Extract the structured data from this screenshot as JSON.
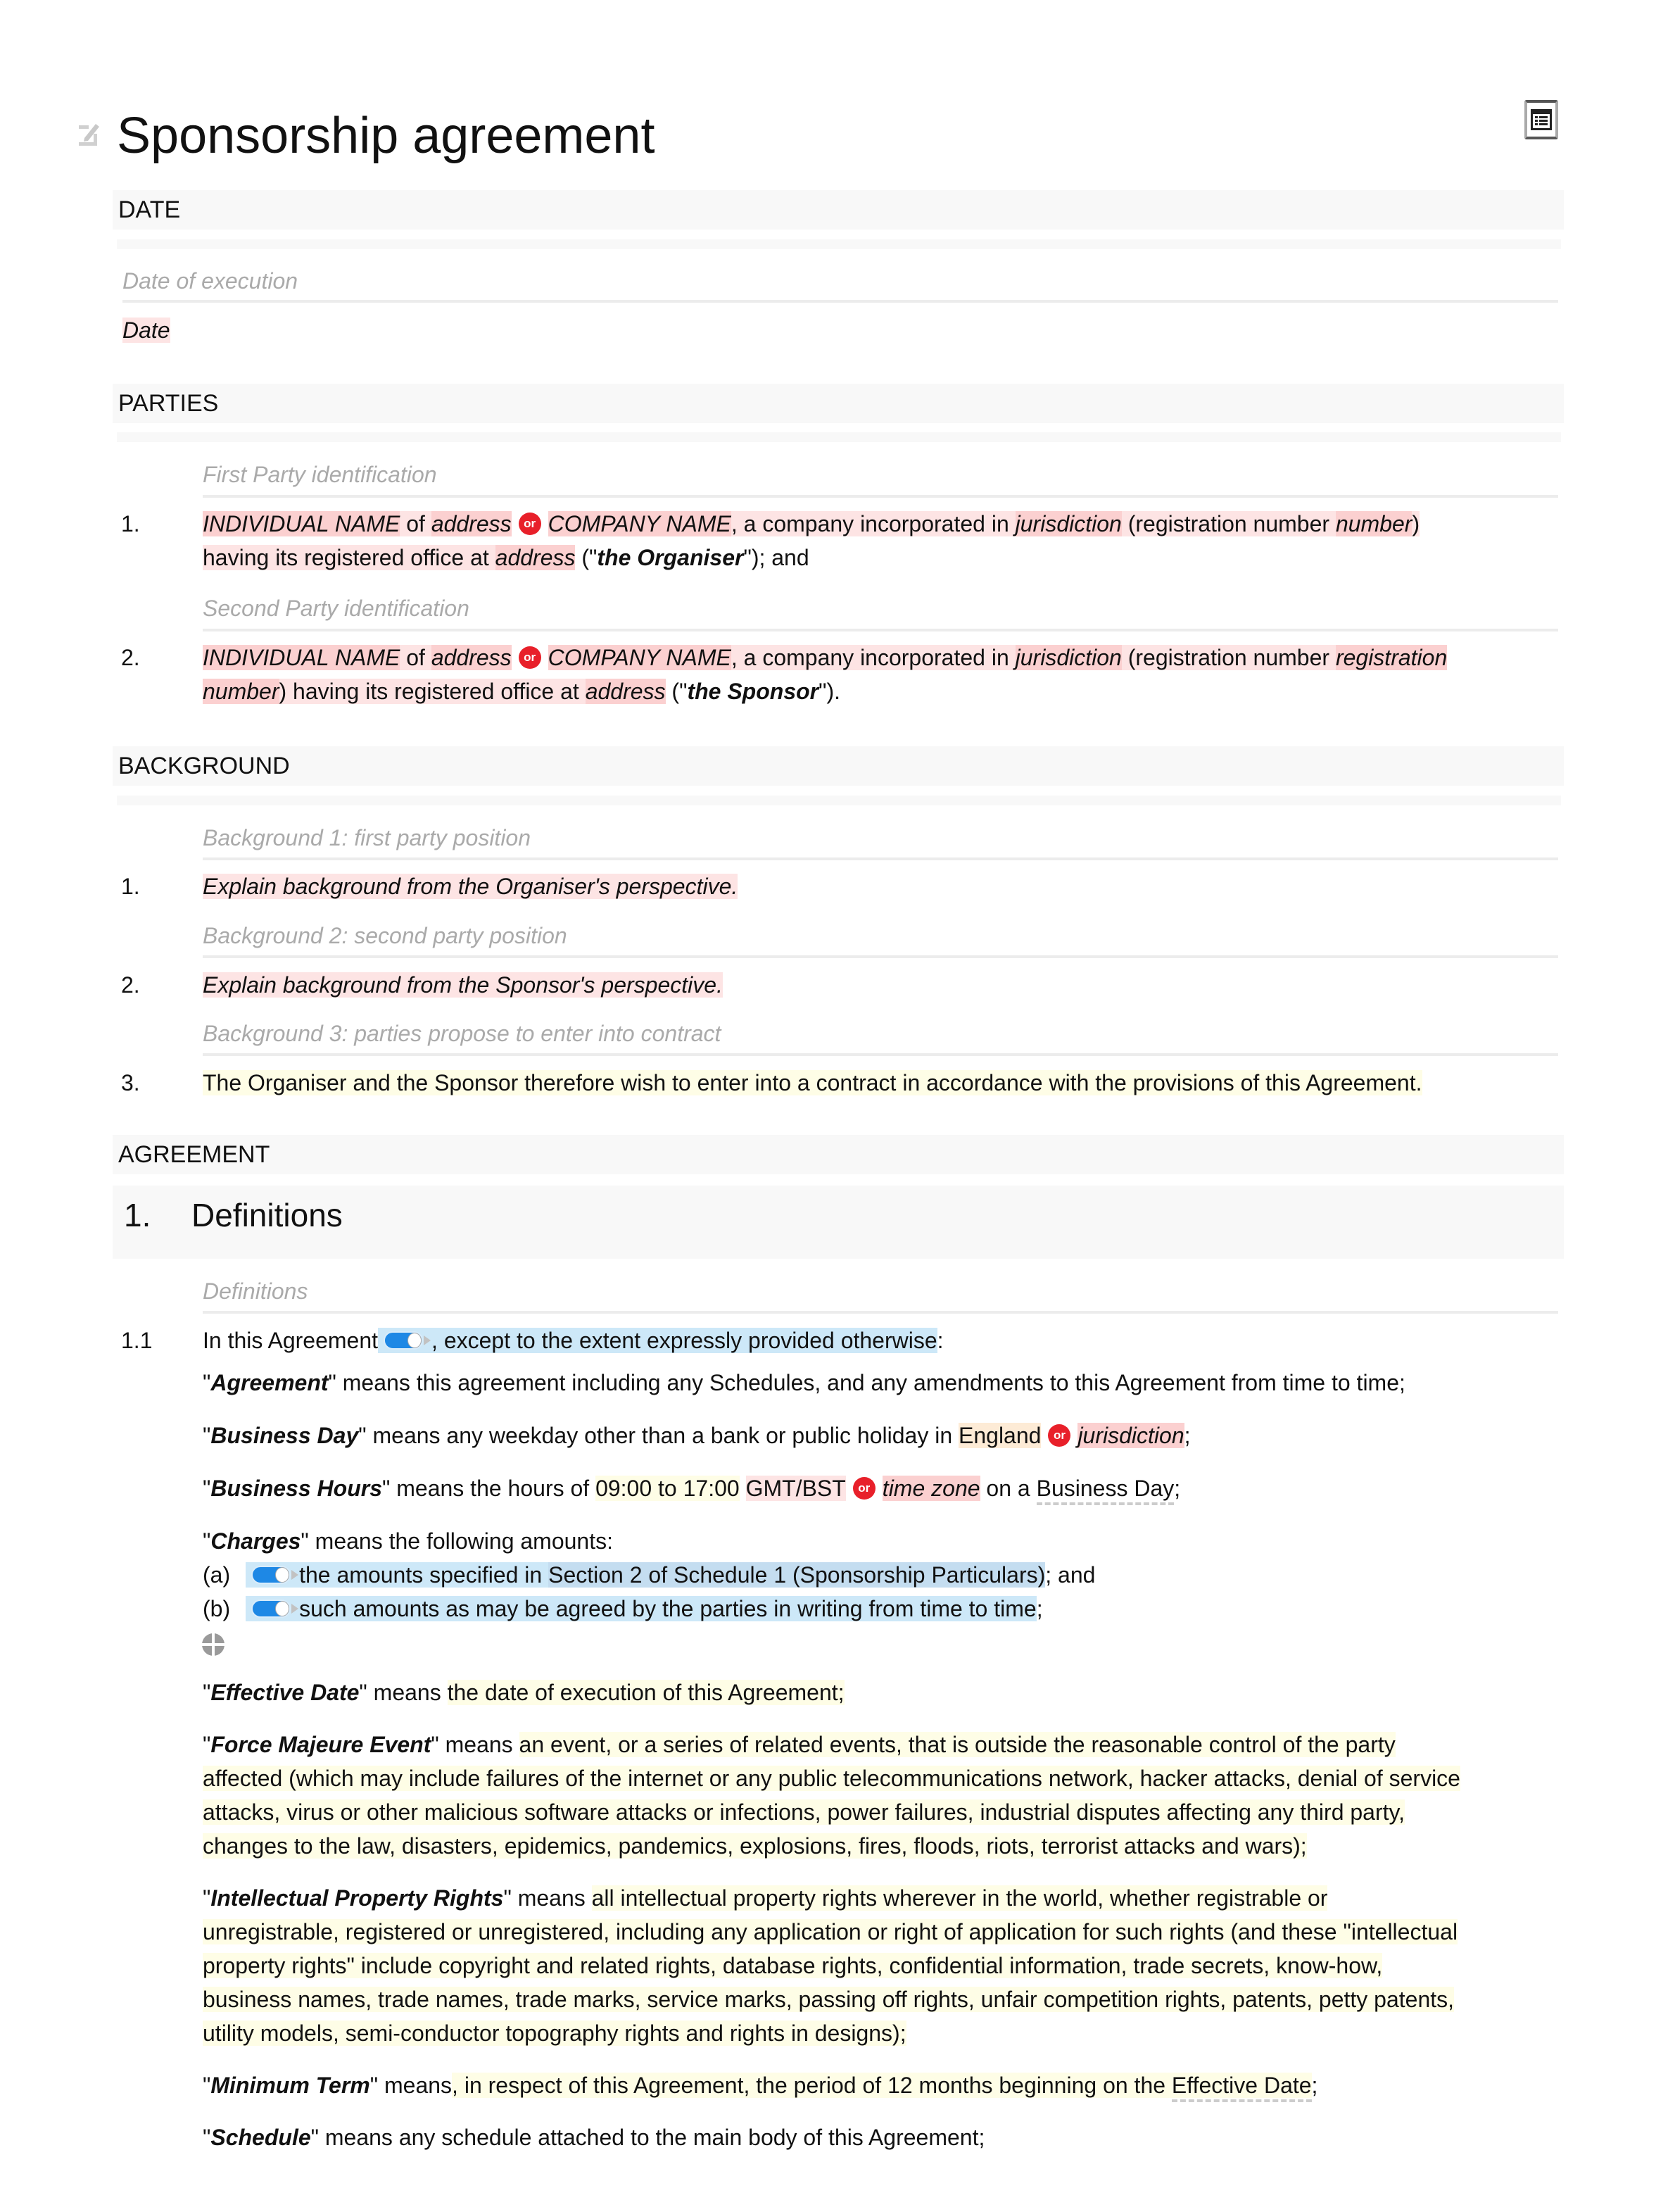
{
  "document": {
    "title": "Sponsorship agreement",
    "toolbar": {
      "edit_icon": "pencil-edit-icon",
      "toc_icon": "table-of-contents-icon"
    }
  },
  "sections": {
    "date": {
      "heading": "DATE",
      "hint": "Date of execution",
      "value": "Date"
    },
    "parties": {
      "heading": "PARTIES",
      "items": [
        {
          "hint": "First Party identification",
          "number": "1.",
          "individual_name": "INDIVIDUAL NAME",
          "of": " of ",
          "individual_address": "address",
          "or_label": "or",
          "company_name": "COMPANY NAME",
          "incorporated_text": ", a company incorporated in ",
          "jurisdiction": "jurisdiction",
          "registration_text": " (registration number ",
          "registration_number": "number",
          "close_paren": ")",
          "office_text": "having its registered office at ",
          "office_address": "address",
          "defined_open": " (\"",
          "defined_term": "the Organiser",
          "defined_close": "\"); and"
        },
        {
          "hint": "Second Party identification",
          "number": "2.",
          "individual_name": "INDIVIDUAL NAME",
          "of": " of ",
          "individual_address": "address",
          "or_label": "or",
          "company_name": "COMPANY NAME",
          "incorporated_text": ", a company incorporated in ",
          "jurisdiction": "jurisdiction",
          "registration_text": " (registration number ",
          "registration_number_line1": "registration",
          "registration_number_line2": "number",
          "office_text": ") having its registered office at ",
          "office_address": "address",
          "defined_open": " (\"",
          "defined_term": "the Sponsor",
          "defined_close": "\")."
        }
      ]
    },
    "background": {
      "heading": "BACKGROUND",
      "items": [
        {
          "hint": "Background 1: first party position",
          "number": "1.",
          "text": "Explain background from the Organiser's perspective."
        },
        {
          "hint": "Background 2: second party position",
          "number": "2.",
          "text": "Explain background from the Sponsor's perspective."
        },
        {
          "hint": "Background 3: parties propose to enter into contract",
          "number": "3.",
          "text": "The Organiser and the Sponsor therefore wish to enter into a contract in accordance with the provisions of this Agreement."
        }
      ]
    },
    "agreement": {
      "heading": "AGREEMENT",
      "clause": {
        "number": "1.",
        "title": "Definitions"
      },
      "hint": "Definitions",
      "sub": {
        "number": "1.1",
        "lead": "In this Agreement",
        "lead_tail": ", except to the extent expressly provided otherwise",
        "lead_colon": ":"
      },
      "definitions": {
        "agreement": {
          "q1": "\"",
          "term": "Agreement",
          "q2": "\"",
          "text": " means this agreement including any Schedules, and any amendments to this Agreement from time to time;"
        },
        "business_day": {
          "q1": "\"",
          "term": "Business Day",
          "q2": "\"",
          "text": " means any weekday other than a bank or public holiday in ",
          "option1": "England",
          "or_label": "or",
          "option2": "jurisdiction",
          "end": ";"
        },
        "business_hours": {
          "q1": "\"",
          "term": "Business Hours",
          "q2": "\"",
          "text": " means the hours of ",
          "hours": "09:00 to 17:00",
          "tz_option1": "GMT/BST",
          "or_label": "or",
          "tz_option2": "time zone",
          "mid": " on a ",
          "link": "Business Day",
          "end": ";"
        },
        "charges": {
          "q1": "\"",
          "term": "Charges",
          "q2": "\"",
          "text": " means the following amounts:",
          "items": [
            {
              "label": "(a)",
              "text": "the amounts specified in ",
              "link": "Section 2 of Schedule 1 (Sponsorship Particulars)",
              "end": "; and",
              "toggle_on": true
            },
            {
              "label": "(b)",
              "text": "such amounts as may be agreed by the parties in writing from time to time",
              "end": ";",
              "toggle_on": true
            }
          ],
          "add_icon": "add-item-icon"
        },
        "effective_date": {
          "q1": "\"",
          "term": "Effective Date",
          "q2": "\"",
          "text": " means ",
          "value": "the date of execution of this Agreement;"
        },
        "force_majeure": {
          "q1": "\"",
          "term": "Force Majeure Event",
          "q2": "\"",
          "text": " means ",
          "lines": [
            "an event, or a series of related events, that is outside the reasonable control of the party",
            "affected (which may include failures of the internet or any public telecommunications network, hacker attacks, denial of service",
            "attacks, virus or other malicious software attacks or infections, power failures, industrial disputes affecting any third party,",
            "changes to the law, disasters, epidemics, pandemics, explosions, fires, floods, riots, terrorist attacks and wars);"
          ]
        },
        "ipr": {
          "q1": "\"",
          "term": "Intellectual Property Rights",
          "q2": "\"",
          "text": " means ",
          "lines": [
            "all intellectual property rights wherever in the world, whether registrable or",
            "unregistrable, registered or unregistered, including any application or right of application for such rights (and these \"intellectual",
            "property rights\" include copyright and related rights, database rights, confidential information, trade secrets, know-how,",
            "business names, trade names, trade marks, service marks, passing off rights, unfair competition rights, patents, petty patents,",
            "utility models, semi-conductor topography rights and rights in designs);"
          ]
        },
        "minimum_term": {
          "q1": "\"",
          "term": "Minimum Term",
          "q2": "\"",
          "text": " means",
          "value": ", in respect of this Agreement, the period of 12 months beginning on the ",
          "link": "Effective Date",
          "end": ";"
        },
        "schedule": {
          "q1": "\"",
          "term": "Schedule",
          "q2": "\"",
          "text": " means any schedule attached to the main body of this Agreement;"
        }
      }
    }
  },
  "colors": {
    "placeholder_highlight": "#fbd0d0",
    "clause_red_highlight": "#fde4e4",
    "yellow_highlight": "#fefde6",
    "orange_highlight": "#fdebd6",
    "blue_highlight": "#cde8f8",
    "or_badge": "#e8202a",
    "toggle": "#1e88e5",
    "hint_text": "#aaaaaa",
    "section_header_bg": "#f8f8f8"
  }
}
